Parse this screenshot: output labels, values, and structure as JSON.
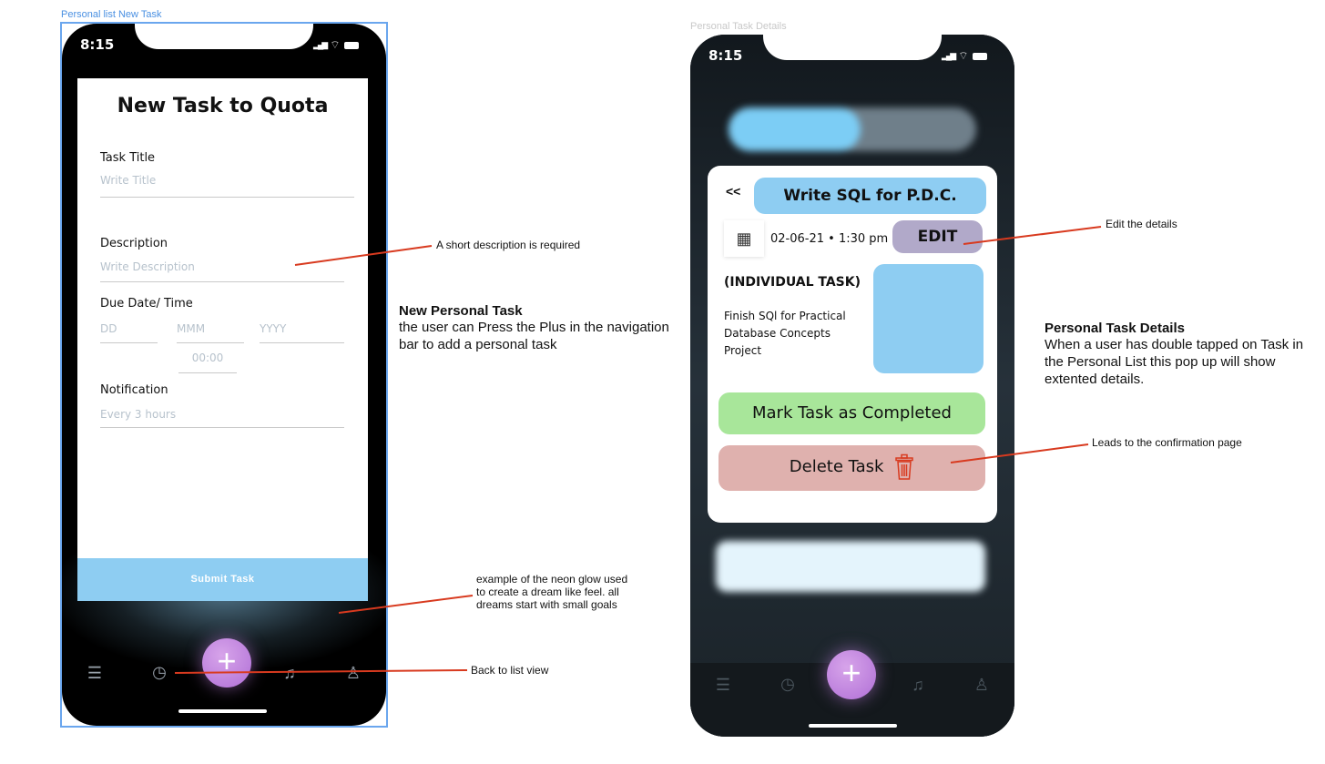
{
  "left": {
    "frame_label": "Personal list New Task",
    "status": {
      "time": "8:15",
      "signal": "▐▐▐",
      "wifi": "◠",
      "battery": "▬"
    },
    "form": {
      "title": "New Task to Quota",
      "task_title_label": "Task Title",
      "task_title_placeholder": "Write Title",
      "description_label": "Description",
      "description_placeholder": "Write Description",
      "due_label": "Due Date/ Time",
      "day_placeholder": "DD",
      "month_placeholder": "MMM",
      "year_placeholder": "YYYY",
      "time_placeholder": "00:00",
      "notification_label": "Notification",
      "notification_placeholder": "Every 3 hours",
      "submit_label": "Submit Task"
    },
    "nav": {
      "list_icon": "list-icon",
      "clock_icon": "clock-icon",
      "plus_icon": "plus-icon",
      "bell_icon": "bell-icon",
      "profile_icon": "profile-icon",
      "plus_glyph": "+"
    }
  },
  "right": {
    "frame_label": "Personal Task Details",
    "status": {
      "time": "8:15"
    },
    "details": {
      "back_label": "<<",
      "title": "Write SQL for P.D.C.",
      "date_time": "02-06-21 • 1:30 pm",
      "edit_label": "EDIT",
      "type_label": "(INDIVIDUAL TASK)",
      "description": "Finish SQl for Practical Database Concepts Project",
      "complete_label": "Mark Task as Completed",
      "delete_label": "Delete Task"
    },
    "nav": {
      "plus_glyph": "+"
    }
  },
  "annotations": {
    "short_description": "A short description is required",
    "new_task_heading": "New Personal Task",
    "new_task_body": "the user can Press the Plus in the navigation bar to add a personal task",
    "neon_glow": "example of the neon glow used to create a dream like feel. all dreams start with small goals",
    "back_to_list": "Back to list view",
    "edit_details": "Edit the details",
    "details_heading": "Personal Task Details",
    "details_body": "When a user has double tapped on Task in the Personal List this pop up will show extented details.",
    "confirmation": "Leads to the confirmation page"
  },
  "colors": {
    "accent_blue": "#8ecdf2",
    "accent_purple": "#b06fd6",
    "complete_green": "#a8e69a",
    "delete_red": "#dfb1ae",
    "edit_lavender": "#b1a9c9",
    "annotation_line": "#d83a1f",
    "selection": "#6aa6ee"
  }
}
